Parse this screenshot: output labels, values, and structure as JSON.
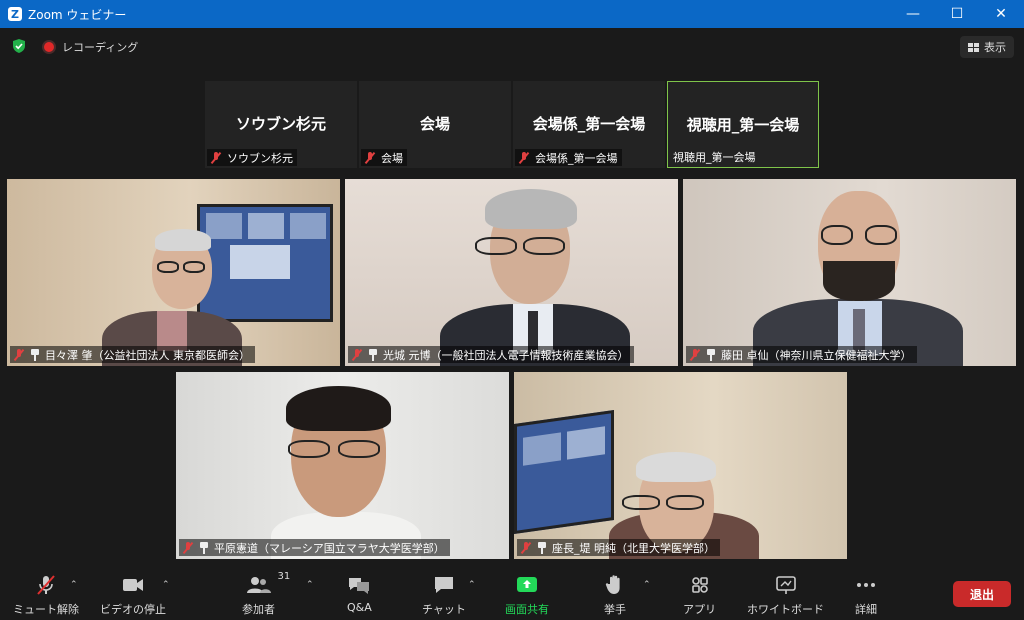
{
  "window": {
    "title": "Zoom ウェビナー"
  },
  "topbar": {
    "recording_label": "レコーディング",
    "view_label": "表示"
  },
  "name_tiles": [
    {
      "big": "ソウブン杉元",
      "label": "ソウブン杉元",
      "muted": true
    },
    {
      "big": "会場",
      "label": "会場",
      "muted": true
    },
    {
      "big": "会場係_第一会場",
      "label": "会場係_第一会場",
      "muted": true
    },
    {
      "big": "視聴用_第一会場",
      "label": "視聴用_第一会場",
      "muted": false
    }
  ],
  "video_tiles": [
    {
      "label": "目々澤 肇（公益社団法人 東京都医師会）"
    },
    {
      "label": "光城 元博（一般社団法人電子情報技術産業協会）"
    },
    {
      "label": "藤田 卓仙（神奈川県立保健福祉大学）"
    },
    {
      "label": "平原憲道（マレーシア国立マラヤ大学医学部）"
    },
    {
      "label": "座長_堤 明純（北里大学医学部）"
    }
  ],
  "toolbar": {
    "unmute": "ミュート解除",
    "stop_video": "ビデオの停止",
    "participants": "参加者",
    "participants_count": "31",
    "qa": "Q&A",
    "chat": "チャット",
    "share": "画面共有",
    "raise_hand": "挙手",
    "apps": "アプリ",
    "whiteboard": "ホワイトボード",
    "more": "詳細",
    "leave": "退出"
  },
  "colors": {
    "titlebar": "#0b68c6",
    "share_green": "#23d959",
    "leave_red": "#c92a2a",
    "active_border": "#7fc44a"
  }
}
